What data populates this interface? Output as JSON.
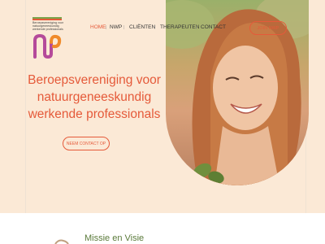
{
  "logo": {
    "text_lines": [
      "Beroepsvereniging voor",
      "natuurgeneeskundig",
      "werkende professionals"
    ],
    "mark": "NWP"
  },
  "nav": {
    "items": [
      "HOME",
      "NWP",
      "CLIËNTEN",
      "THERAPEUTEN",
      "CONTACT"
    ],
    "active": "HOME",
    "join_label": "JOIN NWP"
  },
  "hero": {
    "headline_lines": [
      "Beroepsvereniging voor",
      "natuurgeneeskundig",
      "werkende professionals"
    ],
    "cta_label": "NEEM CONTACT OP"
  },
  "section": {
    "title": "Missie en Visie"
  },
  "colors": {
    "accent": "#e55a3a",
    "hero_bg": "#fbe9d6",
    "section_title": "#5a7a3a"
  }
}
